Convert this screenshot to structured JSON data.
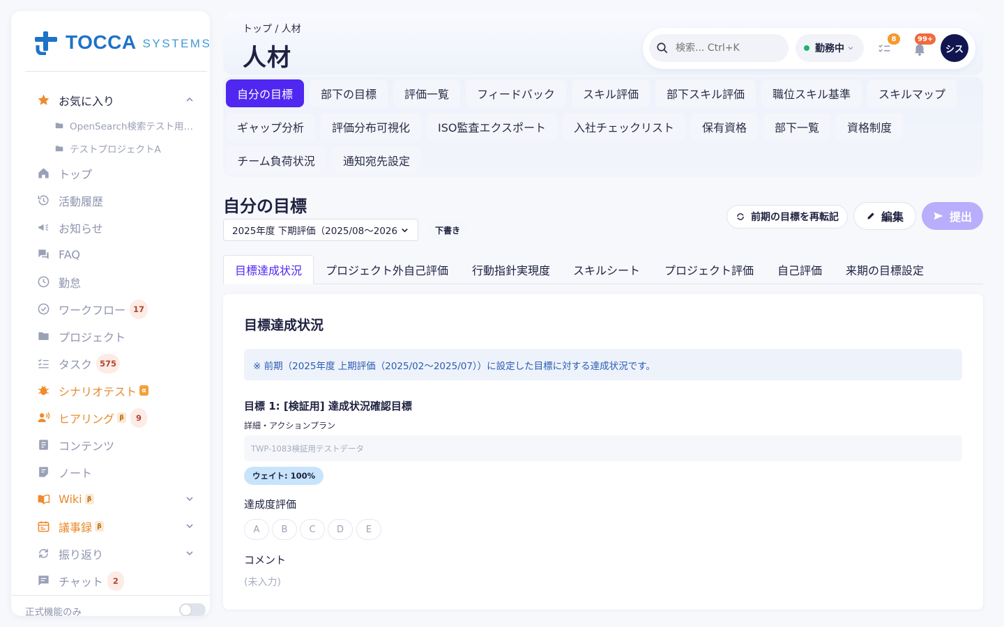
{
  "brand": {
    "name": "TOCCA",
    "sub": "SYSTEMS"
  },
  "sidebar": {
    "favorites": {
      "label": "お気に入り",
      "items": [
        "OpenSearch検索テスト用プロジェクト",
        "テストプロジェクトA"
      ]
    },
    "items": [
      {
        "label": "トップ"
      },
      {
        "label": "活動履歴"
      },
      {
        "label": "お知らせ"
      },
      {
        "label": "FAQ"
      },
      {
        "label": "勤怠"
      },
      {
        "label": "ワークフロー",
        "count": "17"
      },
      {
        "label": "プロジェクト"
      },
      {
        "label": "タスク",
        "count": "575"
      },
      {
        "label": "シナリオテスト",
        "tag": "α"
      },
      {
        "label": "ヒアリング",
        "tag": "β",
        "count": "9"
      },
      {
        "label": "コンテンツ"
      },
      {
        "label": "ノート"
      },
      {
        "label": "Wiki",
        "tag": "β"
      },
      {
        "label": "議事録",
        "tag": "β"
      },
      {
        "label": "振り返り"
      },
      {
        "label": "チャット",
        "count": "2"
      }
    ],
    "footer_label": "正式機能のみ"
  },
  "header": {
    "breadcrumb": "トップ / 人材",
    "title": "人材",
    "search_placeholder": "検索... Ctrl+K",
    "status": "勤務中",
    "task_badge": "8",
    "notif_badge": "99+",
    "avatar": "シス"
  },
  "tabs": [
    "自分の目標",
    "部下の目標",
    "評価一覧",
    "フィードバック",
    "スキル評価",
    "部下スキル評価",
    "職位スキル基準",
    "スキルマップ",
    "ギャップ分析",
    "評価分布可視化",
    "ISO監査エクスポート",
    "入社チェックリスト",
    "保有資格",
    "部下一覧",
    "資格制度",
    "チーム負荷状況",
    "通知宛先設定"
  ],
  "section": {
    "title": "自分の目標",
    "period": "2025年度 下期評価（2025/08〜2026/01）",
    "draft": "下書き",
    "repost_label": "前期の目標を再転記",
    "edit_label": "編集",
    "submit_label": "提出"
  },
  "subtabs": [
    "目標達成状況",
    "プロジェクト外自己評価",
    "行動指針実現度",
    "スキルシート",
    "プロジェクト評価",
    "自己評価",
    "来期の目標設定"
  ],
  "card": {
    "title": "目標達成状況",
    "info": "※ 前期（2025年度 上期評価（2025/02〜2025/07））に設定した目標に対する達成状況です。",
    "goal_title": "目標 1: [検証用] 達成状況確認目標",
    "detail_label": "詳細・アクションプラン",
    "detail_value": "TWP-1083検証用テストデータ",
    "weight": "ウェイト: 100%",
    "eval_label": "達成度評価",
    "grades": [
      "A",
      "B",
      "C",
      "D",
      "E"
    ],
    "comment_label": "コメント",
    "comment_value": "(未入力)"
  }
}
